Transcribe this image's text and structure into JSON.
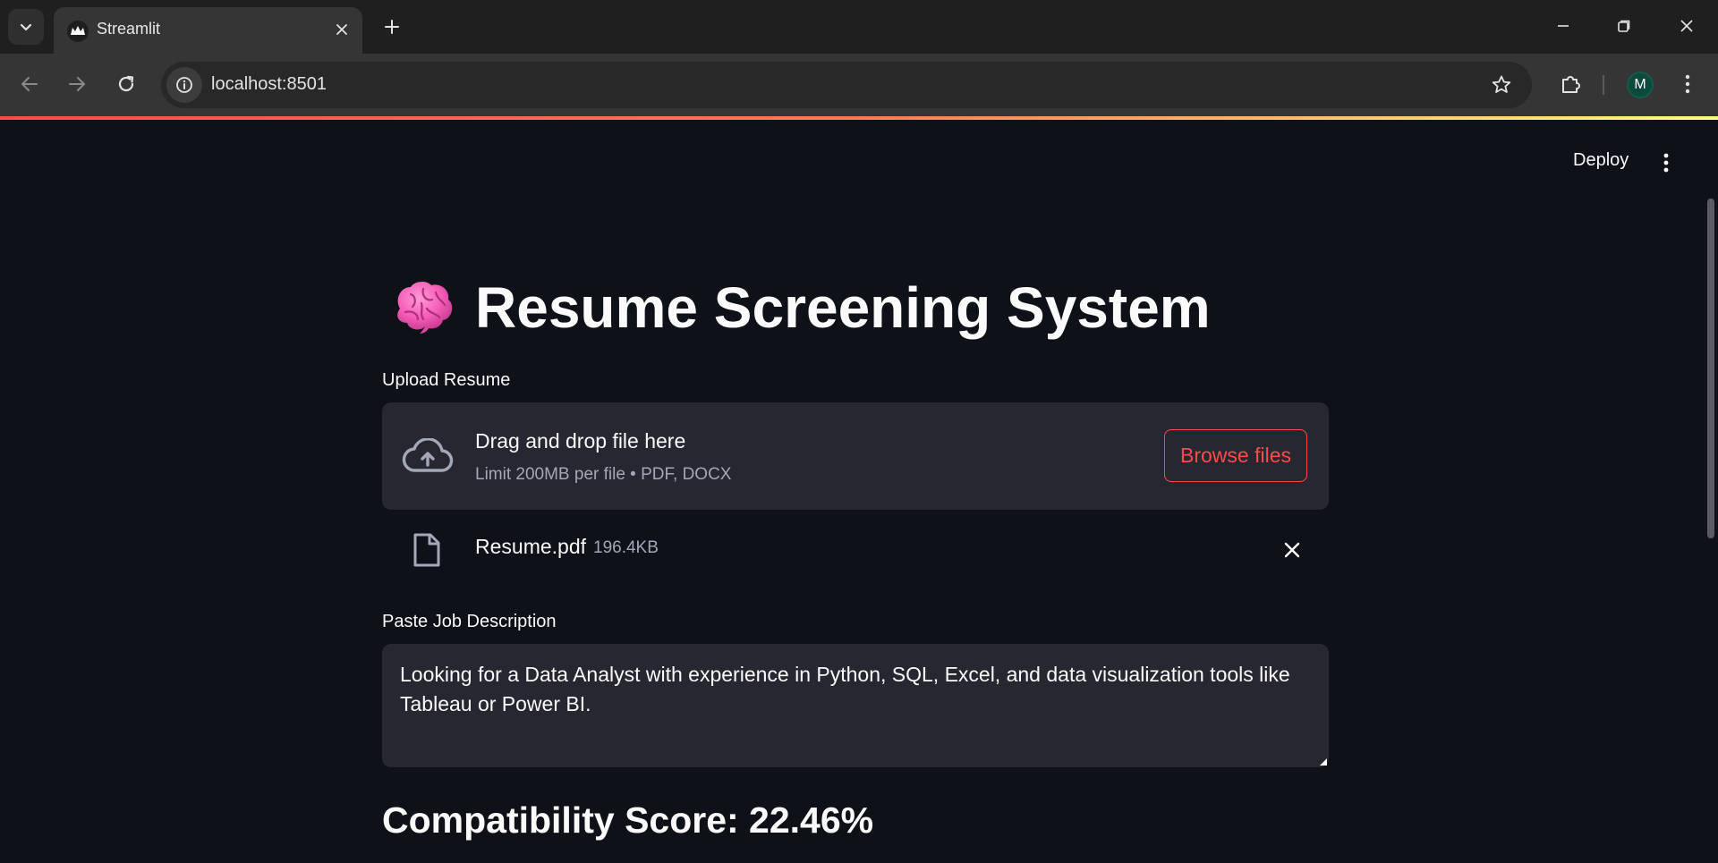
{
  "browser": {
    "tab_title": "Streamlit",
    "url": "localhost:8501",
    "profile_initial": "M"
  },
  "app": {
    "deploy_label": "Deploy",
    "title": "Resume Screening System",
    "upload_label": "Upload Resume",
    "dropzone_title": "Drag and drop file here",
    "dropzone_limit": "Limit 200MB per file • PDF, DOCX",
    "browse_label": "Browse files",
    "uploaded_file": {
      "name": "Resume.pdf",
      "size": "196.4KB"
    },
    "jd_label": "Paste Job Description",
    "jd_value": "Looking for a Data Analyst with experience in Python, SQL, Excel, and data visualization tools like Tableau or Power BI.",
    "score_text": "Compatibility Score: 22.46%"
  },
  "colors": {
    "background": "#0e1117",
    "surface": "#262730",
    "accent": "#ff4b4b",
    "muted_text": "#a3a8b8"
  }
}
